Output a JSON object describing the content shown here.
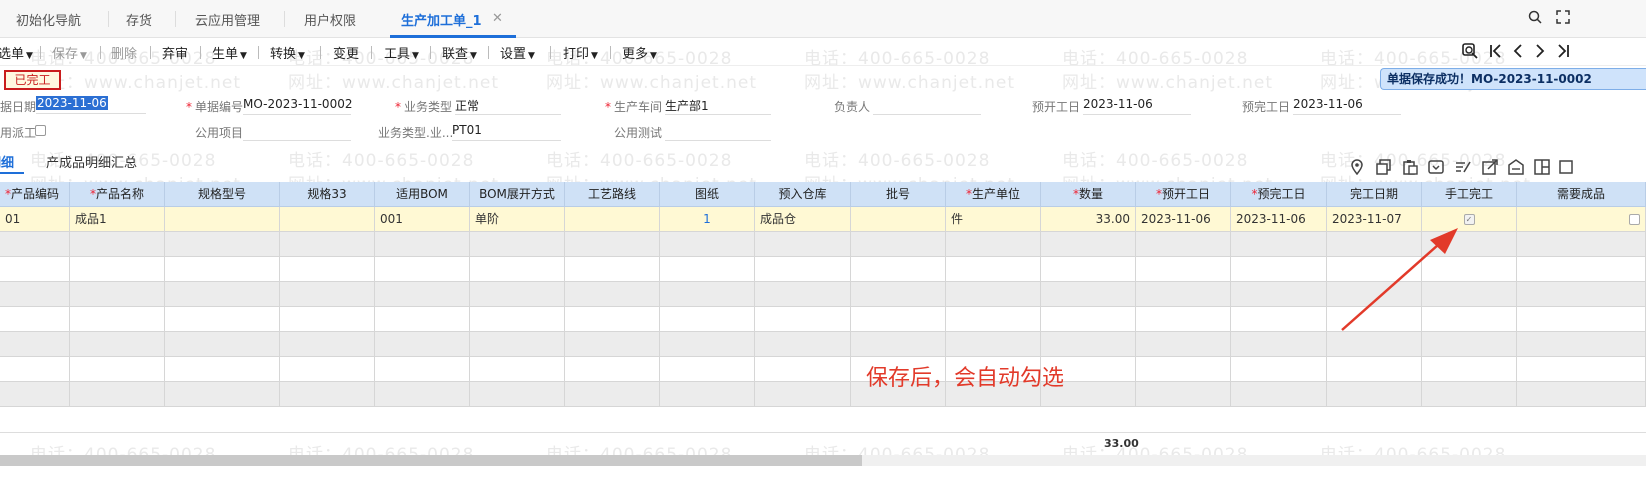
{
  "tabs": [
    {
      "label": "初始化导航"
    },
    {
      "label": "存货"
    },
    {
      "label": "云应用管理"
    },
    {
      "label": "用户权限"
    },
    {
      "label": "生产加工单_1"
    }
  ],
  "tab_close": "✕",
  "toolbar": {
    "items": [
      {
        "label": "选单"
      },
      {
        "label": "保存"
      },
      {
        "label": "删除"
      },
      {
        "label": "弃审"
      },
      {
        "label": "生单"
      },
      {
        "label": "转换"
      },
      {
        "label": "变更"
      },
      {
        "label": "工具"
      },
      {
        "label": "联查"
      },
      {
        "label": "设置"
      },
      {
        "label": "打印"
      },
      {
        "label": "更多"
      }
    ]
  },
  "status_badge": "已完工",
  "toast": "单据保存成功！MO-2023-11-0002",
  "form": {
    "doc_date_label": "据日期",
    "doc_date_value": "2023-11-06",
    "doc_no_label": "单据编号",
    "doc_no_value": "MO-2023-11-0002",
    "biz_type_label": "业务类型",
    "biz_type_value": "正常",
    "workshop_label": "生产车间",
    "workshop_value": "生产部1",
    "owner_label": "负责人",
    "owner_value": "",
    "plan_start_label": "预开工日",
    "plan_start_value": "2023-11-06",
    "plan_end_label": "预完工日",
    "plan_end_value": "2023-11-06",
    "dispatch_label": "用派工",
    "public_item_label": "公用项目",
    "biz_type2_label": "业务类型.业...",
    "biz_type2_value": "PT01",
    "public_test_label": "公用测试"
  },
  "subtabs": [
    {
      "label": "明细"
    },
    {
      "label": "产成品明细汇总"
    }
  ],
  "grid": {
    "columns": [
      {
        "label": "产品编码",
        "required": true
      },
      {
        "label": "产品名称",
        "required": true
      },
      {
        "label": "规格型号",
        "required": false
      },
      {
        "label": "规格33",
        "required": false
      },
      {
        "label": "适用BOM",
        "required": false
      },
      {
        "label": "BOM展开方式",
        "required": false
      },
      {
        "label": "工艺路线",
        "required": false
      },
      {
        "label": "图纸",
        "required": false
      },
      {
        "label": "预入仓库",
        "required": false
      },
      {
        "label": "批号",
        "required": false
      },
      {
        "label": "生产单位",
        "required": true
      },
      {
        "label": "数量",
        "required": true
      },
      {
        "label": "预开工日",
        "required": true
      },
      {
        "label": "预完工日",
        "required": true
      },
      {
        "label": "完工日期",
        "required": false
      },
      {
        "label": "手工完工",
        "required": false
      },
      {
        "label": "需要成品",
        "required": false
      }
    ],
    "row1": {
      "code": "01",
      "name": "成品1",
      "spec": "",
      "spec33": "",
      "bom": "001",
      "bom_mode": "单阶",
      "route": "",
      "drawing": "1",
      "warehouse": "成品仓",
      "batch": "",
      "unit": "件",
      "qty": "33.00",
      "plan_start": "2023-11-06",
      "plan_end": "2023-11-06",
      "finish_date": "2023-11-07",
      "manual_finish": true,
      "need_product": false
    },
    "total_qty": "33.00"
  },
  "annotation": "保存后，会自动勾选",
  "watermark": {
    "phone": "电话：400-665-0028",
    "site": "网址：www.chanjet.net"
  },
  "colors": {
    "accent": "#1e6fd9",
    "required": "#e23",
    "annotation": "#e23a2a",
    "header_bg": "#cfe1f6",
    "selected_row": "#fff9d4"
  }
}
